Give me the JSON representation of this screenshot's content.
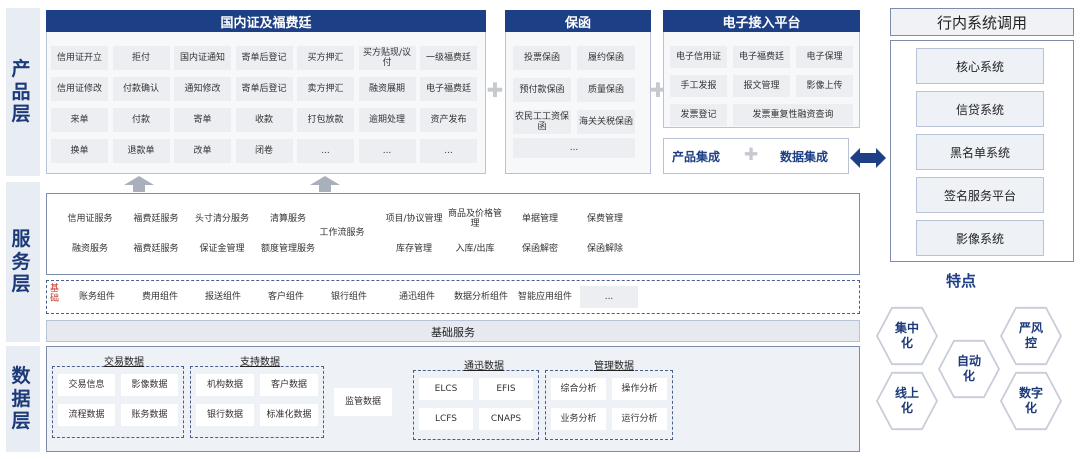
{
  "layers": {
    "product": "产品层",
    "service": "服务层",
    "data": "数据层"
  },
  "domestic": {
    "title": "国内证及福费廷",
    "cells": [
      "信用证开立",
      "拒付",
      "国内证通知",
      "寄单后登记",
      "买方押汇",
      "买方贴现/议付",
      "一级福费廷",
      "信用证修改",
      "付款确认",
      "通知修改",
      "寄单后登记",
      "卖方押汇",
      "融资展期",
      "电子福费廷",
      "来单",
      "付款",
      "寄单",
      "收款",
      "打包放款",
      "逾期处理",
      "资产发布",
      "换单",
      "退款单",
      "改单",
      "闭卷",
      "...",
      "...",
      "..."
    ]
  },
  "guarantee": {
    "title": "保函",
    "cells": [
      "投票保函",
      "履约保函",
      "预付款保函",
      "质量保函",
      "农民工工资保函",
      "海关关税保函",
      "..."
    ]
  },
  "eaccess": {
    "title": "电子接入平台",
    "cells": [
      "电子信用证",
      "电子福费廷",
      "电子保理",
      "手工发报",
      "报文管理",
      "影像上传",
      "发票登记",
      "发票重复性融资查询"
    ]
  },
  "integration": {
    "product": "产品集成",
    "data": "数据集成"
  },
  "services": {
    "cells": [
      "信用证服务",
      "福费廷服务",
      "头寸清分服务",
      "清算服务",
      "工作流服务",
      "项目/协议管理",
      "商品及价格管理",
      "单据管理",
      "保费管理",
      "融资服务",
      "福费廷服务",
      "保证金管理",
      "额度管理服务",
      "库存管理",
      "入库/出库",
      "保函解密",
      "保函解除"
    ],
    "base_label": "基础",
    "components": [
      "账务组件",
      "费用组件",
      "报送组件",
      "客户组件",
      "银行组件",
      "通迅组件",
      "数据分析组件",
      "智能应用组件",
      "..."
    ],
    "foundation": "基础服务"
  },
  "data": {
    "trade": {
      "title": "交易数据",
      "cells": [
        "交易信息",
        "影像数据",
        "流程数据",
        "账务数据"
      ]
    },
    "support": {
      "title": "支持数据",
      "cells": [
        "机构数据",
        "客户数据",
        "银行数据",
        "标准化数据"
      ]
    },
    "supervise": "监管数据",
    "comm": {
      "title": "通迅数据",
      "cells": [
        "ELCS",
        "EFIS",
        "LCFS",
        "CNAPS"
      ]
    },
    "mgmt": {
      "title": "管理数据",
      "cells": [
        "综合分析",
        "操作分析",
        "业务分析",
        "运行分析"
      ]
    }
  },
  "internal": {
    "title": "行内系统调用",
    "systems": [
      "核心系统",
      "信贷系统",
      "黑名单系统",
      "签名服务平台",
      "影像系统"
    ]
  },
  "features": {
    "title": "特点",
    "items": [
      "集中化",
      "严风控",
      "自动化",
      "线上化",
      "数字化"
    ]
  },
  "colors": {
    "primary": "#1d3f86",
    "cell": "#eceef2"
  }
}
